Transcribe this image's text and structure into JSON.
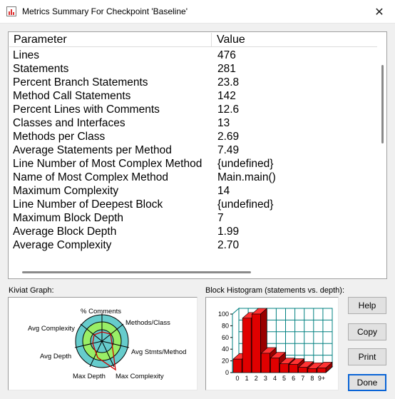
{
  "window": {
    "title": "Metrics Summary For Checkpoint 'Baseline'",
    "close_glyph": "✕"
  },
  "table": {
    "columns": [
      "Parameter",
      "Value"
    ],
    "rows": [
      [
        "Lines",
        "476"
      ],
      [
        "Statements",
        "281"
      ],
      [
        "Percent Branch Statements",
        "23.8"
      ],
      [
        "Method Call Statements",
        "142"
      ],
      [
        "Percent Lines with Comments",
        "12.6"
      ],
      [
        "Classes and Interfaces",
        "13"
      ],
      [
        "Methods per Class",
        "2.69"
      ],
      [
        "Average Statements per Method",
        "7.49"
      ],
      [
        "Line Number of Most Complex Method",
        "{undefined}"
      ],
      [
        "Name of Most Complex Method",
        "Main.main()"
      ],
      [
        "Maximum Complexity",
        "14"
      ],
      [
        "Line Number of Deepest Block",
        "{undefined}"
      ],
      [
        "Maximum Block Depth",
        "7"
      ],
      [
        "Average Block Depth",
        "1.99"
      ],
      [
        "Average Complexity",
        "2.70"
      ]
    ]
  },
  "kiviat": {
    "section_label": "Kiviat Graph:",
    "axes": [
      "% Comments",
      "Methods/Class",
      "Avg Stmts/Method",
      "Max Complexity",
      "Max Depth",
      "Avg Depth",
      "Avg Complexity"
    ]
  },
  "histogram": {
    "section_label": "Block Histogram (statements vs. depth):"
  },
  "chart_data": {
    "type": "bar",
    "title": "Block Histogram (statements vs. depth):",
    "categories": [
      "0",
      "1",
      "2",
      "3",
      "4",
      "5",
      "6",
      "7",
      "8",
      "9+"
    ],
    "values": [
      23,
      93,
      100,
      33,
      25,
      15,
      14,
      9,
      7,
      8
    ],
    "yticks": [
      "0",
      "20",
      "40",
      "60",
      "80",
      "100"
    ],
    "ylim": [
      0,
      100
    ],
    "grid": true,
    "bar_color": "#e00000",
    "grid_color": "#008080"
  },
  "buttons": {
    "help": "Help",
    "copy": "Copy",
    "print": "Print",
    "done": "Done"
  }
}
